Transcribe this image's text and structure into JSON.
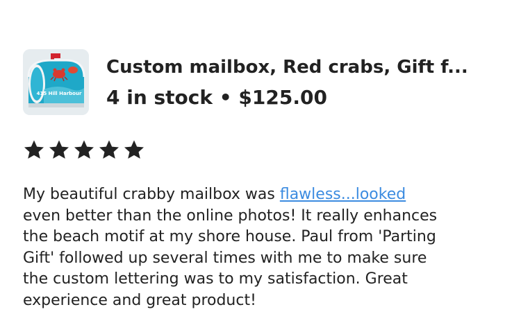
{
  "listing": {
    "title": "Custom mailbox, Red crabs, Gift f...",
    "stock": "4 in stock",
    "separator": " • ",
    "price": "$125.00",
    "thumbnail_icon": "mailbox-thumbnail",
    "thumbnail_text": "415 Hill Harbour"
  },
  "rating": {
    "stars": 5,
    "max": 5,
    "icon": "star-icon",
    "color": "#222222"
  },
  "review": {
    "line1_before": "My beautiful crabby mailbox was ",
    "line1_link": "flawless...looked",
    "line2": "even better than the online photos!  It really enhances",
    "line3": "the beach motif at my shore house.  Paul from 'Parting",
    "line4": "Gift' followed up several times with me to make sure",
    "line5": "the custom lettering was to my satisfaction.  Great",
    "line6": "experience and great product!"
  },
  "colors": {
    "text": "#222222",
    "link": "#3b8be0",
    "background": "#ffffff"
  }
}
